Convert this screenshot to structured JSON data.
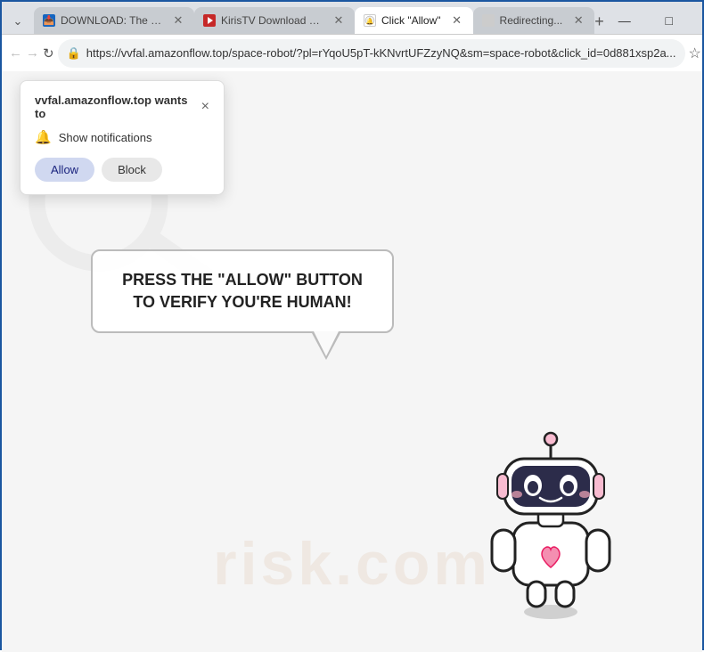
{
  "browser": {
    "tabs": [
      {
        "id": "tab1",
        "favicon": "📥",
        "title": "DOWNLOAD: The Killer...",
        "active": false,
        "closable": true,
        "favicon_type": "blue"
      },
      {
        "id": "tab2",
        "favicon": "▶",
        "title": "KirisTV Download Page...",
        "active": false,
        "closable": true,
        "favicon_type": "red"
      },
      {
        "id": "tab3",
        "favicon": "🔔",
        "title": "Click \"Allow\"",
        "active": true,
        "closable": true,
        "favicon_type": "white"
      },
      {
        "id": "tab4",
        "favicon": "⟳",
        "title": "Redirecting...",
        "active": false,
        "closable": true,
        "favicon_type": "gray"
      }
    ],
    "address_bar": {
      "url": "https://vvfal.amazonflow.top/space-robot/?pl=rYqoU5pT-kKNvrtUFZzyNQ&sm=space-robot&click_id=0d881xsp2a...",
      "lock_icon": "🔒"
    },
    "window_controls": {
      "minimize": "—",
      "maximize": "□",
      "close": "✕"
    },
    "nav": {
      "back": "←",
      "forward": "→",
      "refresh": "↻",
      "menu": "⋮"
    }
  },
  "notification_popup": {
    "site_bold": "vvfal.amazonflow.top",
    "site_suffix": " wants to",
    "close_label": "×",
    "permission_label": "Show notifications",
    "allow_label": "Allow",
    "block_label": "Block"
  },
  "page": {
    "watermark_text": "risk.com",
    "speech_bubble_text": "PRESS THE \"ALLOW\" BUTTON TO VERIFY YOU'RE HUMAN!"
  },
  "colors": {
    "browser_border": "#1a56a0",
    "tab_bg_inactive": "#c8ccd1",
    "tab_bg_active": "#ffffff",
    "nav_bg": "#ffffff",
    "page_bg": "#f5f5f5",
    "allow_btn_bg": "#c5cfe8",
    "block_btn_bg": "#e8e8e8"
  }
}
